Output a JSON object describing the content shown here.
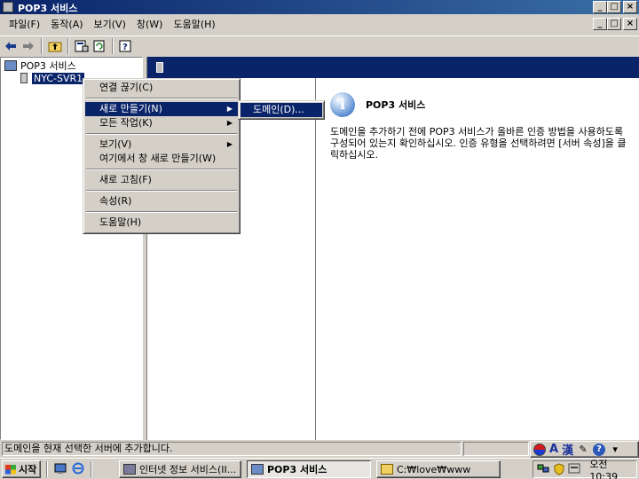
{
  "window": {
    "title": "POP3 서비스",
    "buttons": {
      "minimize": "_",
      "maximize": "□",
      "close": "×"
    }
  },
  "menubar": {
    "items": [
      "파일(F)",
      "동작(A)",
      "보기(V)",
      "창(W)",
      "도움말(H)"
    ]
  },
  "toolbar": {
    "icons": [
      "back-icon",
      "forward-icon",
      "up-folder-icon",
      "properties-icon",
      "refresh-icon",
      "help-icon"
    ]
  },
  "tree": {
    "root": "POP3 서비스",
    "server": "NYC-SVR1"
  },
  "context_menu": {
    "items": [
      "연결 끊기(C)",
      "새로 만들기(N)",
      "모든 작업(K)",
      "보기(V)",
      "여기에서 창 새로 만들기(W)",
      "새로 고침(F)",
      "속성(R)",
      "도움말(H)"
    ],
    "submenu_arrow": "▶"
  },
  "submenu": {
    "items": [
      "도메인(D)..."
    ]
  },
  "info_panel": {
    "title": "POP3 서비스",
    "icon_glyph": "i",
    "text": "도메인을 추가하기 전에 POP3 서비스가 올바른 인증 방법을 사용하도록 구성되어 있는지 확인하십시오. 인증 유형을 선택하려면 [서버 속성]을 클릭하십시오."
  },
  "statusbar": {
    "text": "도메인을 현재 선택한 서버에 추가합니다."
  },
  "ime": {
    "glyph_a": "A",
    "glyph_han": "漢",
    "help": "?"
  },
  "taskbar": {
    "start": "시작",
    "tasks": [
      "인터넷 정보 서비스(II...",
      "POP3 서비스",
      "C:₩love₩www"
    ],
    "clock": "오전 10:39"
  }
}
